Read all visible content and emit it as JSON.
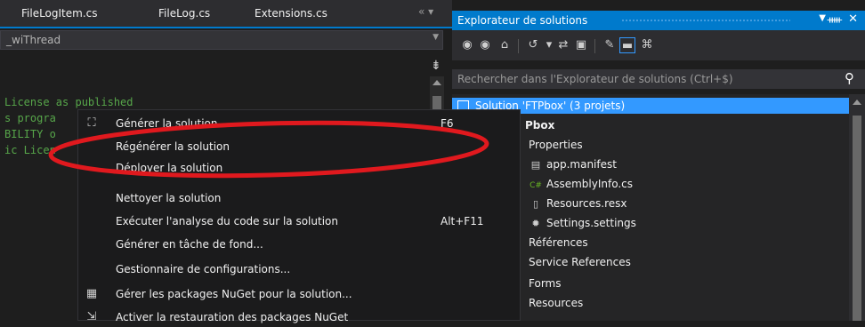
{
  "editor": {
    "tabs": [
      "FileLogItem.cs",
      "FileLog.cs",
      "Extensions.cs"
    ],
    "tabs_controls": "« ▾",
    "combo_value": "_wiThread",
    "code_lines": [
      "License as published",
      "s progra",
      "BILITY o",
      "ic Licen"
    ]
  },
  "solution_explorer": {
    "title": "Explorateur de solutions",
    "pin_icon": "pin-icon",
    "close_icon": "close-icon",
    "search_placeholder": "Rechercher dans l'Explorateur de solutions (Ctrl+$)",
    "selected_item": "Solution 'FTPbox' (3 projets)",
    "tree": [
      {
        "label": "Pbox",
        "icon": ""
      },
      {
        "label": "Properties",
        "icon": ""
      },
      {
        "label": "app.manifest",
        "icon": "manifest-icon"
      },
      {
        "label": "AssemblyInfo.cs",
        "icon": "csharp-icon"
      },
      {
        "label": "Resources.resx",
        "icon": "resx-icon"
      },
      {
        "label": "Settings.settings",
        "icon": "settings-icon"
      },
      {
        "label": "Références",
        "icon": ""
      },
      {
        "label": "Service References",
        "icon": ""
      },
      {
        "label": "Forms",
        "icon": ""
      },
      {
        "label": "Resources",
        "icon": ""
      }
    ]
  },
  "context_menu": {
    "items": [
      {
        "label": "Générer la solution",
        "shortcut": "F6",
        "icon": "build-icon"
      },
      {
        "label": "Régénérer la solution",
        "shortcut": "",
        "icon": ""
      },
      {
        "label": "Déployer la solution",
        "shortcut": "",
        "icon": ""
      },
      {
        "label": "Nettoyer la solution",
        "shortcut": "",
        "icon": ""
      },
      {
        "label": "Exécuter l'analyse du code sur la solution",
        "shortcut": "Alt+F11",
        "icon": ""
      },
      {
        "label": "Générer en tâche de fond...",
        "shortcut": "",
        "icon": ""
      },
      {
        "label": "Gestionnaire de configurations...",
        "shortcut": "",
        "icon": ""
      },
      {
        "label": "Gérer les packages NuGet pour la solution...",
        "shortcut": "",
        "icon": "nuget-icon"
      },
      {
        "label": "Activer la restauration des packages NuGet",
        "shortcut": "",
        "icon": "nuget-restore-icon"
      }
    ]
  },
  "colors": {
    "accent": "#007acc",
    "selection": "#3399ff",
    "annotation": "#e0191e",
    "code_comment": "#57a64a"
  }
}
